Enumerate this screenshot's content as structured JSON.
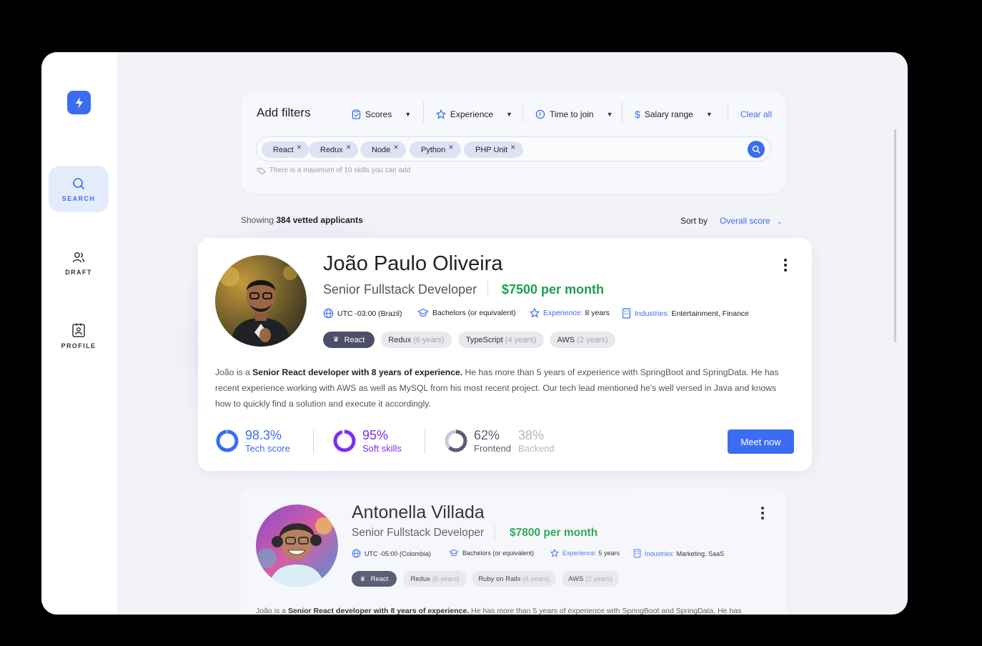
{
  "nav": {
    "logo_icon": "bolt-icon",
    "items": [
      {
        "label": "SEARCH",
        "icon": "search-icon"
      },
      {
        "label": "DRAFT",
        "icon": "users-icon"
      },
      {
        "label": "PROFILE",
        "icon": "id-badge-icon"
      }
    ]
  },
  "filters": {
    "title": "Add filters",
    "dropdowns": [
      {
        "label": "Scores",
        "icon": "clipboard-icon"
      },
      {
        "label": "Experience",
        "icon": "star-icon"
      },
      {
        "label": "Time to join",
        "icon": "clock-icon"
      },
      {
        "label": "Salary range",
        "icon": "dollar-icon"
      }
    ],
    "clear_label": "Clear all",
    "skills": [
      "React",
      "Redux",
      "Node",
      "Python",
      "PHP Unit"
    ],
    "hint": "There is a maximum of 10 skills you can add"
  },
  "results": {
    "showing_prefix": "Showing",
    "showing_count": "384 vetted applicants",
    "sort_label": "Sort by",
    "sort_value": "Overall score"
  },
  "candidates": [
    {
      "name": "João Paulo Oliveira",
      "role": "Senior Fullstack Developer",
      "salary": "$7500 per month",
      "timezone": "UTC -03:00 (Brazil)",
      "education": "Bachelors (or equivalent)",
      "experience_key": "Experience:",
      "experience_val": "8 years",
      "industries_key": "Industries:",
      "industries_val": "Entertainment, Finance",
      "tags": [
        {
          "name": "React",
          "years": ""
        },
        {
          "name": "Redux",
          "years": "(6 years)"
        },
        {
          "name": "TypeScript",
          "years": "(4 years)"
        },
        {
          "name": "AWS",
          "years": "(2 years)"
        }
      ],
      "desc_prefix": "João is a ",
      "desc_bold": "Senior React developer with 8 years of experience.",
      "desc_rest": " He has more than 5 years of experience with SpringBoot and SpringData. He has recent experience working with AWS as well as MySQL from his most recent project. Our tech lead mentioned he's well versed in Java and knows how to quickly find a solution and execute it accordingly.",
      "metrics": {
        "tech_value": "98.3%",
        "tech_label": "Tech score",
        "tech_fraction": 0.983,
        "soft_value": "95%",
        "soft_label": "Soft skills",
        "soft_fraction": 0.95,
        "frontend_value": "62%",
        "frontend_label": "Frontend",
        "frontend_fraction": 0.62,
        "backend_value": "38%",
        "backend_label": "Backend"
      },
      "cta": "Meet now"
    },
    {
      "name": "Antonella Villada",
      "role": "Senior Fullstack Developer",
      "salary": "$7800 per month",
      "timezone": "UTC -05:00 (Colombia)",
      "education": "Bachelors (or equivalent)",
      "experience_key": "Experience:",
      "experience_val": "5 years",
      "industries_key": "Industries:",
      "industries_val": "Marketing, SaaS",
      "tags": [
        {
          "name": "React",
          "years": ""
        },
        {
          "name": "Redux",
          "years": "(6 years)"
        },
        {
          "name": "Ruby on Rails",
          "years": "(4 years)"
        },
        {
          "name": "AWS",
          "years": "(2 years)"
        }
      ],
      "desc_prefix": "João is a ",
      "desc_bold": "Senior React developer with 8 years of experience.",
      "desc_rest": " He has more than 5 years of experience with SpringBoot and SpringData. He has"
    }
  ],
  "colors": {
    "accent": "#3b6cf2",
    "salary": "#1aa14a",
    "soft_skills": "#7b2ff0",
    "frontend": "#5a5e74"
  }
}
